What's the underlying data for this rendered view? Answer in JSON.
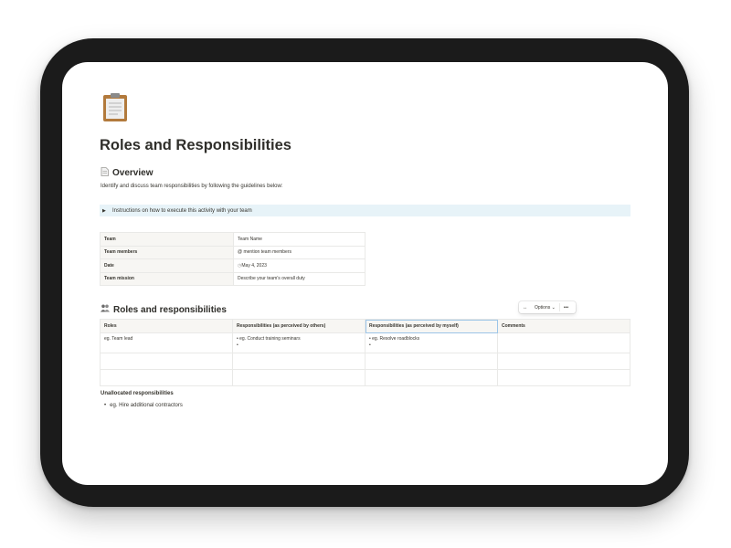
{
  "page": {
    "icon": "clipboard-icon",
    "title": "Roles and Responsibilities"
  },
  "overview": {
    "icon": "page-icon",
    "heading": "Overview",
    "description": "Identify and discuss team responsibilities by following the guidelines below:",
    "toggle_label": "Instructions on how to execute this activity with your team"
  },
  "properties": [
    {
      "key": "Team",
      "value": "Team Name"
    },
    {
      "key": "Team members",
      "value": "@ mention team members"
    },
    {
      "key": "Date",
      "value": "May 4, 2023"
    },
    {
      "key": "Team mission",
      "value": "Describe your team's overall duty"
    }
  ],
  "roles": {
    "icon": "people-icon",
    "heading": "Roles and responsibilities",
    "columns": [
      "Roles",
      "Responsibilities (as perceived by others)",
      "Responsibilities (as perceived by myself)",
      "Comments"
    ],
    "rows": [
      {
        "role": "eg. Team lead",
        "others": "eg. Conduct training seminars",
        "myself": "eg. Resolve roadblocks",
        "comments": ""
      }
    ],
    "toolbar": {
      "expand_icon": "expand-arrows-icon",
      "options_label": "Options",
      "more_icon": "more-dots-icon"
    }
  },
  "unallocated": {
    "heading": "Unallocated responsibilities",
    "items": [
      "eg. Hire additional contractors"
    ]
  },
  "colors": {
    "callout_bg": "#e7f3f8",
    "header_bg": "#f7f6f3",
    "border": "#e9e9e7",
    "device": "#1b1b1b",
    "selected_header": "#9cc5e8"
  }
}
